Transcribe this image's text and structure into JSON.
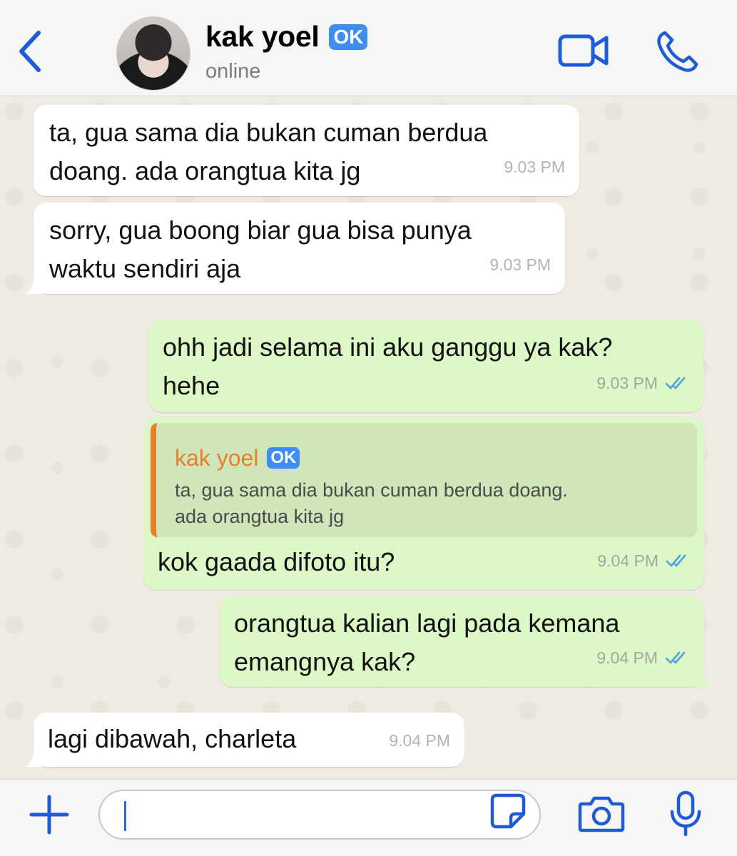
{
  "header": {
    "contact_name": "kak yoel",
    "contact_badge": "OK",
    "contact_status": "online",
    "icons": [
      "back-chevron-icon",
      "video-call-icon",
      "phone-call-icon"
    ],
    "accent_color": "#1f5bd4"
  },
  "messages": [
    {
      "direction": "in",
      "text": "ta, gua sama dia bukan cuman berdua\ndoang. ada orangtua kita jg",
      "time": "9.03 PM"
    },
    {
      "direction": "in",
      "text": "sorry, gua boong biar gua bisa punya\nwaktu sendiri aja",
      "time": "9.03 PM"
    },
    {
      "direction": "out",
      "text": "ohh jadi selama ini aku ganggu ya kak?\nhehe",
      "time": "9.03 PM",
      "status": "read"
    },
    {
      "direction": "out",
      "reply_to": {
        "name": "kak yoel",
        "badge": "OK",
        "text": "ta, gua sama dia bukan cuman berdua doang.\nada orangtua kita jg"
      },
      "text": "kok gaada difoto itu?",
      "time": "9.04 PM",
      "status": "read"
    },
    {
      "direction": "out",
      "text": "orangtua kalian lagi pada kemana\nemangnya kak?",
      "time": "9.04 PM",
      "status": "read"
    },
    {
      "direction": "in",
      "text": "lagi dibawah, charleta",
      "time": "9.04 PM"
    }
  ],
  "composer": {
    "input_value": "",
    "icons": [
      "plus-icon",
      "sticker-icon",
      "camera-icon",
      "microphone-icon"
    ]
  },
  "colors": {
    "incoming_bubble": "#ffffff",
    "outgoing_bubble": "#dcf8c6",
    "quote_bar": "#e87d2a",
    "read_tick": "#4fa3e0",
    "badge": "#3d8ef0"
  }
}
